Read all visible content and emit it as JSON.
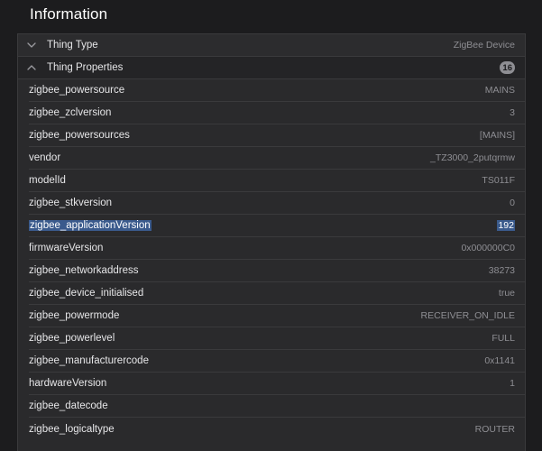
{
  "section": {
    "title": "Information"
  },
  "thing_type": {
    "label": "Thing Type",
    "value": "ZigBee Device"
  },
  "thing_properties": {
    "label": "Thing Properties",
    "count": "16",
    "items": [
      {
        "key": "zigbee_powersource",
        "value": "MAINS"
      },
      {
        "key": "zigbee_zclversion",
        "value": "3"
      },
      {
        "key": "zigbee_powersources",
        "value": "[MAINS]"
      },
      {
        "key": "vendor",
        "value": "_TZ3000_2putqrmw"
      },
      {
        "key": "modelId",
        "value": "TS011F"
      },
      {
        "key": "zigbee_stkversion",
        "value": "0"
      },
      {
        "key": "zigbee_applicationVersion",
        "value": "192"
      },
      {
        "key": "firmwareVersion",
        "value": "0x000000C0"
      },
      {
        "key": "zigbee_networkaddress",
        "value": "38273"
      },
      {
        "key": "zigbee_device_initialised",
        "value": "true"
      },
      {
        "key": "zigbee_powermode",
        "value": "RECEIVER_ON_IDLE"
      },
      {
        "key": "zigbee_powerlevel",
        "value": "FULL"
      },
      {
        "key": "zigbee_manufacturercode",
        "value": "0x1141"
      },
      {
        "key": "hardwareVersion",
        "value": "1"
      },
      {
        "key": "zigbee_datecode",
        "value": ""
      },
      {
        "key": "zigbee_logicaltype",
        "value": "ROUTER"
      }
    ]
  },
  "icons": {
    "thing_type_toggle": "chevron-down-icon",
    "thing_properties_toggle": "chevron-up-icon"
  },
  "colors": {
    "background": "#1c1c1e",
    "row_background": "#2a2a2c",
    "selection": "#3a5a8c",
    "muted_text": "#8e8e93"
  }
}
